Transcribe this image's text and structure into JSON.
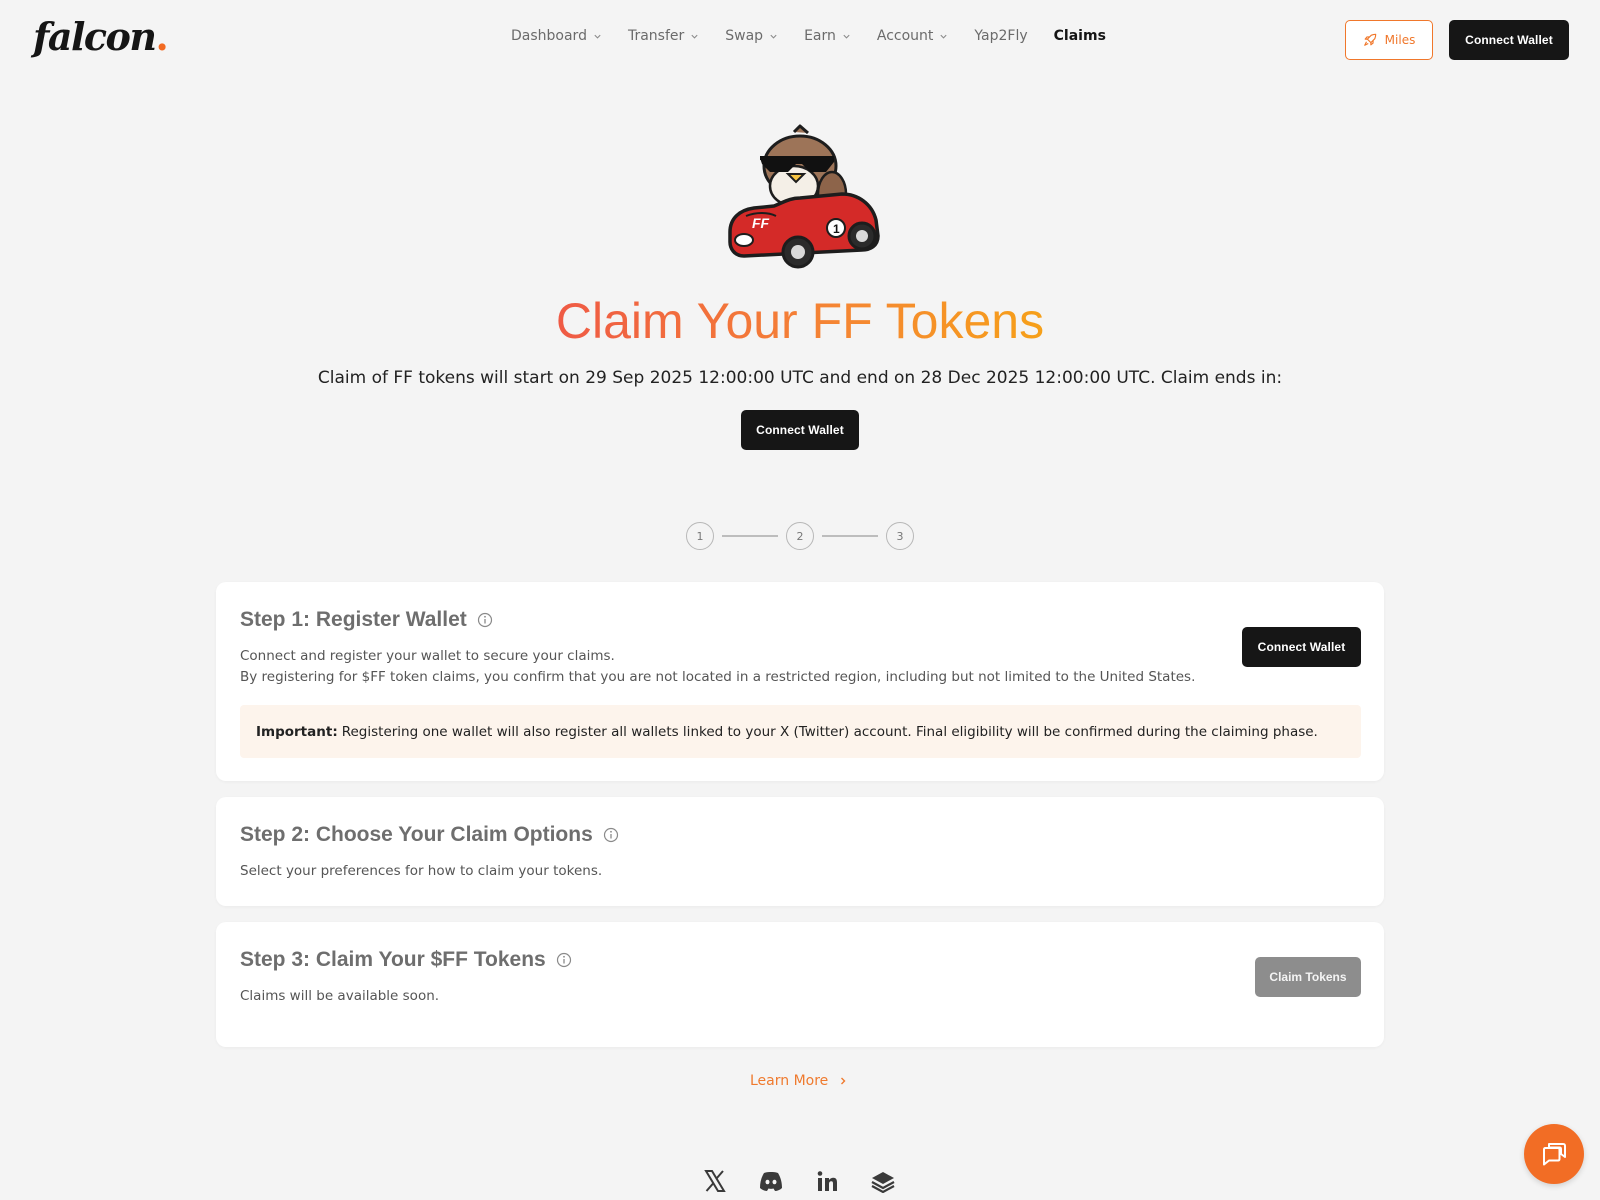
{
  "brand": {
    "logo_text": "falcon",
    "logo_dot": ".",
    "accent": "#f26a22"
  },
  "nav": {
    "items": [
      {
        "label": "Dashboard",
        "dropdown": true
      },
      {
        "label": "Transfer",
        "dropdown": true
      },
      {
        "label": "Swap",
        "dropdown": true
      },
      {
        "label": "Earn",
        "dropdown": true
      },
      {
        "label": "Account",
        "dropdown": true
      },
      {
        "label": "Yap2Fly",
        "dropdown": false
      },
      {
        "label": "Claims",
        "dropdown": false,
        "active": true
      }
    ]
  },
  "header": {
    "miles_label": "Miles",
    "miles_icon": "rocket-icon",
    "connect_label": "Connect Wallet"
  },
  "hero": {
    "title": "Claim Your FF Tokens",
    "subtitle": "Claim of FF tokens will start on 29 Sep 2025 12:00:00 UTC and end on 28 Dec 2025 12:00:00 UTC. Claim ends in:",
    "connect_label": "Connect Wallet"
  },
  "stepper": {
    "steps": [
      "1",
      "2",
      "3"
    ]
  },
  "steps": {
    "step1": {
      "title": "Step 1: Register Wallet",
      "line1": "Connect and register your wallet to secure your claims.",
      "line2": "By registering for $FF token claims, you confirm that you are not located in a restricted region, including but not limited to the United States.",
      "button": "Connect Wallet",
      "important_label": "Important:",
      "important_text": "Registering one wallet will also register all wallets linked to your X (Twitter) account. Final eligibility will be confirmed during the claiming phase."
    },
    "step2": {
      "title": "Step 2: Choose Your Claim Options",
      "text": "Select your preferences for how to claim your tokens."
    },
    "step3": {
      "title": "Step 3: Claim Your $FF Tokens",
      "text": "Claims will be available soon.",
      "button": "Claim Tokens"
    }
  },
  "learn_more": "Learn More",
  "socials": [
    "x-icon",
    "discord-icon",
    "linkedin-icon",
    "gitbook-icon"
  ],
  "colors": {
    "orange": "#f0772b",
    "dark": "#161616",
    "disabled": "#8d8d8d"
  }
}
